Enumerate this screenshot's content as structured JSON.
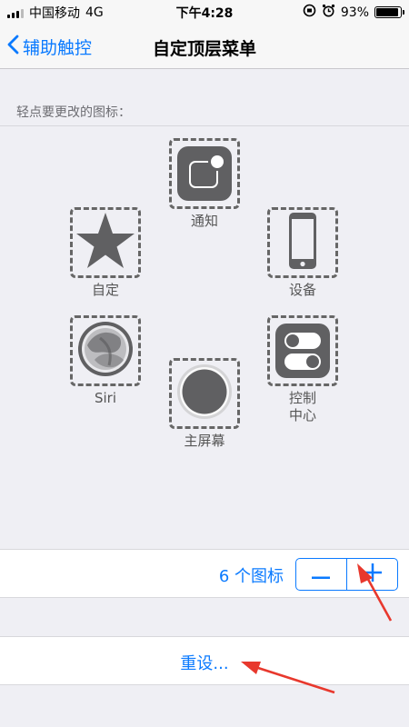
{
  "status_bar": {
    "carrier": "中国移动",
    "network": "4G",
    "time": "下午4:28",
    "battery_percent_text": "93%",
    "battery_level": 0.93
  },
  "nav": {
    "back_label": "辅助触控",
    "title": "自定顶层菜单"
  },
  "section_header": "轻点要更改的图标：",
  "icons": {
    "notifications": "通知",
    "custom": "自定",
    "device": "设备",
    "siri": "Siri",
    "control_center": "控制中心",
    "home": "主屏幕"
  },
  "counter": {
    "label": "6 个图标",
    "minus": "—",
    "plus": "+"
  },
  "reset_label": "重设...",
  "colors": {
    "accent": "#0a7aff",
    "arrow": "#e8382d",
    "icon_gray": "#606062"
  }
}
